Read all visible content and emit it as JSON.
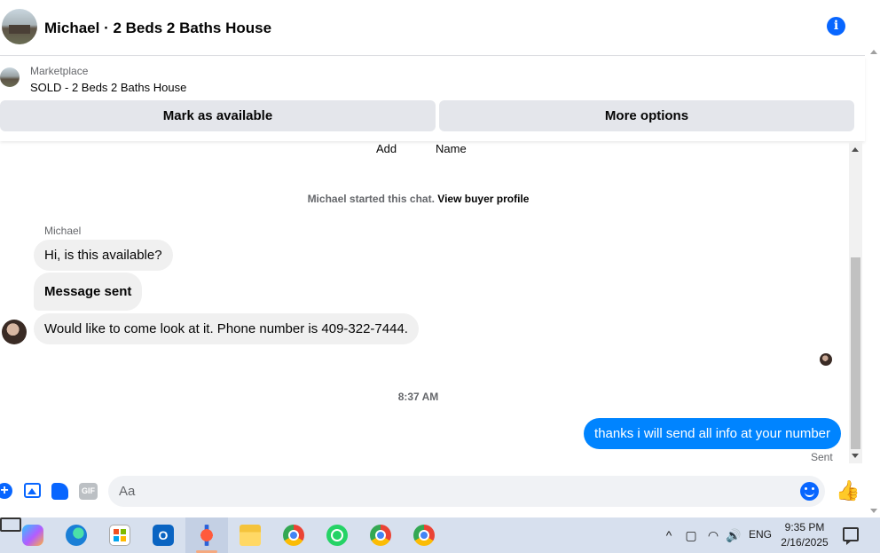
{
  "header": {
    "title": "Michael · 2 Beds 2 Baths House",
    "info_icon": "i"
  },
  "listing": {
    "source": "Marketplace",
    "item": "SOLD - 2 Beds 2 Baths House",
    "buttons": {
      "mark_available": "Mark as available",
      "more_options": "More options"
    }
  },
  "chat": {
    "top_cut": {
      "left": "Add",
      "right": "Name"
    },
    "started": {
      "text": "Michael started this chat.",
      "link": "View buyer profile"
    },
    "sender_name": "Michael",
    "incoming": [
      "Hi, is this available?",
      "Message sent",
      "Would like to come look at it. Phone number is 409-322-7444."
    ],
    "timestamp": "8:37 AM",
    "outgoing": "thanks i will send all info at your number",
    "status": "Sent"
  },
  "composer": {
    "placeholder": "Aa",
    "plus_glyph": "+",
    "gif_label": "GIF",
    "like_glyph": "👍"
  },
  "taskbar": {
    "apps": [
      "copilot-icon",
      "edge-icon",
      "store-icon",
      "outlook-icon",
      "snipping-tool-icon",
      "file-explorer-icon",
      "chrome-icon",
      "whatsapp-icon",
      "chrome-profile-icon",
      "chrome-profile-2-icon"
    ],
    "outlook_glyph": "O",
    "language": "ENG",
    "time": "9:35 PM",
    "date": "2/16/2025",
    "tray": {
      "chevron": "^",
      "wifi": "◠",
      "volume": "🔊"
    }
  },
  "colors": {
    "accent": "#0866ff",
    "outgoing_bubble": "#0084ff",
    "incoming_bubble": "#f0f0f0",
    "button_bg": "#e4e6eb",
    "taskbar_bg": "#d7e0ee"
  }
}
